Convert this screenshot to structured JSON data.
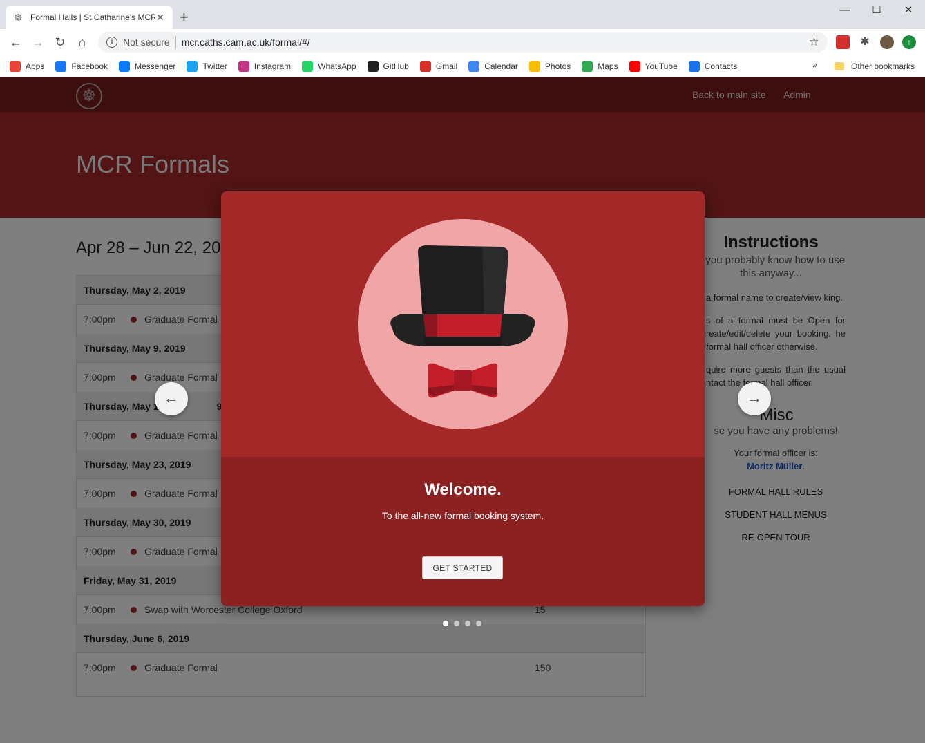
{
  "browser": {
    "tab_title": "Formal Halls | St Catharine's MCR",
    "new_tab": "+",
    "window": {
      "minimize": "—",
      "maximize": "☐",
      "close": "✕"
    },
    "nav": {
      "back": "←",
      "forward": "→",
      "reload": "↻",
      "home": "⌂"
    },
    "security_label": "Not secure",
    "url": "mcr.caths.cam.ac.uk/formal/#/",
    "bookmarks": [
      {
        "label": "Apps",
        "icon": "apps-grid-icon",
        "color": "#e94235"
      },
      {
        "label": "Facebook",
        "icon": "facebook-icon",
        "color": "#1877f2"
      },
      {
        "label": "Messenger",
        "icon": "messenger-icon",
        "color": "#0a7cff"
      },
      {
        "label": "Twitter",
        "icon": "twitter-icon",
        "color": "#1da1f2"
      },
      {
        "label": "Instagram",
        "icon": "instagram-icon",
        "color": "#c13584"
      },
      {
        "label": "WhatsApp",
        "icon": "whatsapp-icon",
        "color": "#25d366"
      },
      {
        "label": "GitHub",
        "icon": "github-icon",
        "color": "#222222"
      },
      {
        "label": "Gmail",
        "icon": "gmail-icon",
        "color": "#d93025"
      },
      {
        "label": "Calendar",
        "icon": "calendar-icon",
        "color": "#4285f4"
      },
      {
        "label": "Photos",
        "icon": "photos-icon",
        "color": "#fbbc04"
      },
      {
        "label": "Maps",
        "icon": "maps-icon",
        "color": "#34a853"
      },
      {
        "label": "YouTube",
        "icon": "youtube-icon",
        "color": "#ff0000"
      },
      {
        "label": "Contacts",
        "icon": "contacts-icon",
        "color": "#1a73e8"
      }
    ],
    "bookmarks_more": "»",
    "other_bookmarks": "Other bookmarks"
  },
  "site": {
    "nav_links": [
      "Back to main site",
      "Admin"
    ],
    "hero_title": "MCR Formals",
    "date_range": "Apr 28 – Jun 22, 20",
    "days": [
      {
        "date": "Thursday, May 2, 2019",
        "events": [
          {
            "time": "7:00pm",
            "name": "Graduate Formal",
            "count": ""
          }
        ]
      },
      {
        "date": "Thursday, May 9, 2019",
        "events": [
          {
            "time": "7:00pm",
            "name": "Graduate Formal",
            "count": ""
          }
        ]
      },
      {
        "date": "Thursday, May 1",
        "date_tail": "9",
        "events": [
          {
            "time": "7:00pm",
            "name": "Graduate Formal",
            "count": ""
          }
        ]
      },
      {
        "date": "Thursday, May 23, 2019",
        "events": [
          {
            "time": "7:00pm",
            "name": "Graduate Formal",
            "count": ""
          }
        ]
      },
      {
        "date": "Thursday, May 30, 2019",
        "events": [
          {
            "time": "7:00pm",
            "name": "Graduate Formal",
            "count": ""
          }
        ]
      },
      {
        "date": "Friday, May 31, 2019",
        "events": [
          {
            "time": "7:00pm",
            "name": "Swap with Worcester College Oxford",
            "count": "15"
          }
        ]
      },
      {
        "date": "Thursday, June 6, 2019",
        "events": [
          {
            "time": "7:00pm",
            "name": "Graduate Formal",
            "count": "150"
          }
        ]
      }
    ],
    "sidebar": {
      "instructions_title": "Instructions",
      "instructions_sub": "n you probably know how to use this anyway...",
      "para1": "a formal name to create/view king.",
      "para2": "s of a formal must be Open for reate/edit/delete your booking. he formal hall officer otherwise.",
      "para3": "quire more guests than the usual ntact the formal hall officer.",
      "misc_title": "Misc",
      "misc_sub": "se you have any problems!",
      "officer_label": "Your formal officer is:",
      "officer_name": "Moritz Müller",
      "officer_period": ".",
      "links": [
        "FORMAL HALL RULES",
        "STUDENT HALL MENUS",
        "RE-OPEN TOUR"
      ]
    }
  },
  "modal": {
    "title": "Welcome.",
    "subtitle": "To the all-new formal booking system.",
    "button": "GET STARTED",
    "prev": "←",
    "next": "→",
    "pages": 4,
    "active_page": 1,
    "colors": {
      "top": "#a52828",
      "bottom": "#8b2121",
      "circle": "#f0a6a6"
    }
  }
}
